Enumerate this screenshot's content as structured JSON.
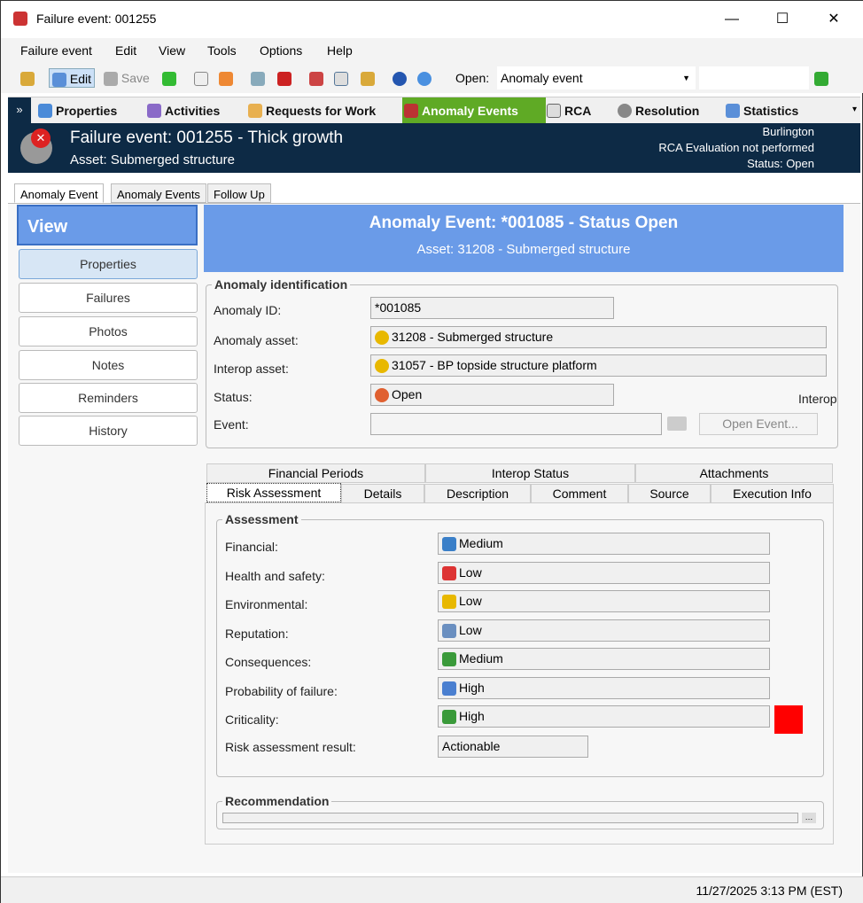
{
  "window": {
    "title": "Failure event: 001255",
    "minimize": "—",
    "maximize": "☐",
    "close": "✕"
  },
  "menu": [
    "Failure event",
    "Edit",
    "View",
    "Tools",
    "Options",
    "Help"
  ],
  "toolbar": {
    "edit": "Edit",
    "save": "Save",
    "open_label": "Open:",
    "open_value": "Anomaly event"
  },
  "nav": [
    "Properties",
    "Activities",
    "Requests for Work",
    "Anomaly Events",
    "RCA",
    "Resolution",
    "Statistics"
  ],
  "header": {
    "title": "Failure event: 001255 - Thick growth",
    "asset": "Asset: Submerged structure",
    "location": "Burlington",
    "rca": "RCA Evaluation not performed",
    "status": "Status: Open"
  },
  "subtabs": [
    "Anomaly Event",
    "Anomaly Events",
    "Follow Up"
  ],
  "view": {
    "title": "View",
    "items": [
      "Properties",
      "Failures",
      "Photos",
      "Notes",
      "Reminders",
      "History"
    ]
  },
  "banner": {
    "title": "Anomaly Event: *001085 - Status Open",
    "subtitle": "Asset: 31208 - Submerged structure"
  },
  "ident": {
    "title": "Anomaly identification",
    "labels": [
      "Anomaly ID:",
      "Anomaly asset:",
      "Interop  asset:",
      "Status:",
      "Event:"
    ],
    "id": "*001085",
    "asset": "31208 - Submerged structure",
    "interop": "31057 - BP topside structure platform",
    "status": "Open",
    "event": "",
    "interop_label": "Interop",
    "open_event": "Open Event..."
  },
  "tabs_row1": [
    "Financial Periods",
    "Interop Status",
    "Attachments"
  ],
  "tabs_row2": [
    "Risk Assessment",
    "Details",
    "Description",
    "Comment",
    "Source",
    "Execution Info"
  ],
  "assessment": {
    "title": "Assessment",
    "rows": [
      {
        "label": "Financial:",
        "value": "Medium",
        "color": "#3a7fc8"
      },
      {
        "label": "Health and safety:",
        "value": "Low",
        "color": "#d33"
      },
      {
        "label": "Environmental:",
        "value": "Low",
        "color": "#e8b800"
      },
      {
        "label": "Reputation:",
        "value": "Low",
        "color": "#6a8fc0"
      },
      {
        "label": "Consequences:",
        "value": "Medium",
        "color": "#3a9a3a"
      },
      {
        "label": "Probability of failure:",
        "value": "High",
        "color": "#4a7fd0"
      },
      {
        "label": "Criticality:",
        "value": "High",
        "color": "#3a9a3a"
      }
    ],
    "result_label": "Risk assessment result:",
    "result": "Actionable",
    "criticality_color": "#ff0000"
  },
  "recommendation": {
    "title": "Recommendation"
  },
  "statusbar": {
    "datetime": "11/27/2025 3:13 PM (EST)"
  }
}
